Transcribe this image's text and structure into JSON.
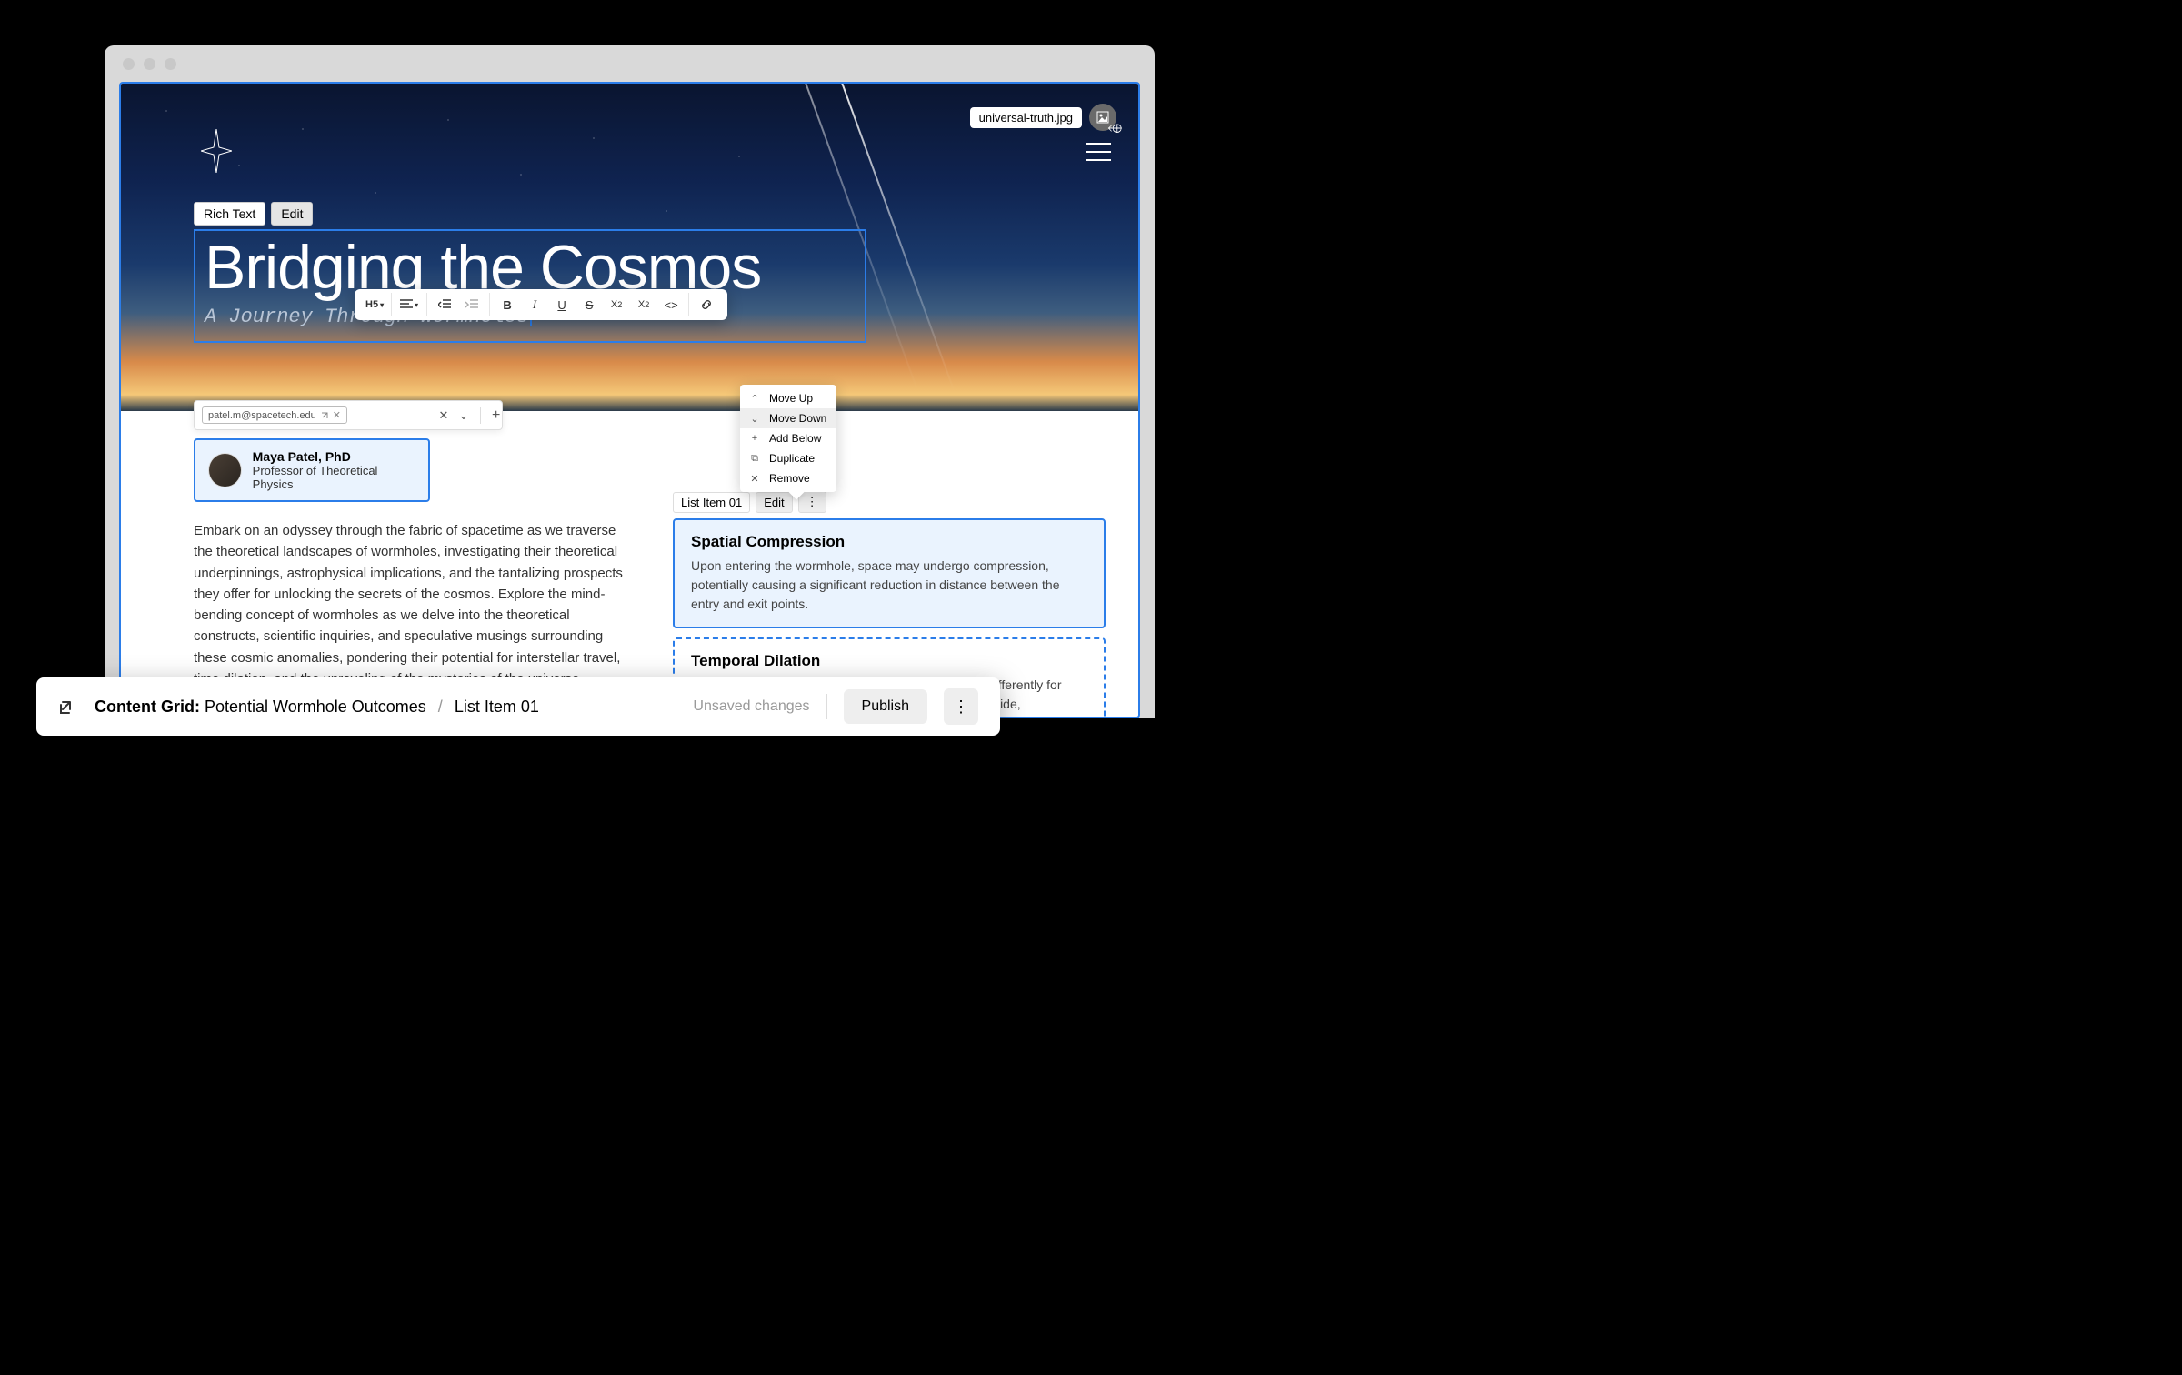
{
  "hero": {
    "image_name": "universal-truth.jpg",
    "field_label": "Rich Text",
    "edit_label": "Edit",
    "title": "Bridging the Cosmos",
    "subtitle": "A Journey Through Wormholes"
  },
  "rt_toolbar": {
    "heading": "H5",
    "buttons": [
      "align",
      "indent-left",
      "indent-right",
      "B",
      "I",
      "U",
      "S",
      "X₂",
      "X²",
      "<>",
      "link"
    ]
  },
  "author_toolbar": {
    "email_chip": "patel.m@spacetech.edu"
  },
  "author": {
    "name": "Maya Patel, PhD",
    "title": "Professor of Theoretical Physics"
  },
  "article_paragraph": "Embark on an odyssey through the fabric of spacetime as we traverse the theoretical landscapes of wormholes, investigating their theoretical underpinnings, astrophysical implications, and the tantalizing prospects they offer for unlocking the secrets of the cosmos. Explore the mind-bending concept of wormholes as we delve into the theoretical constructs, scientific inquiries, and speculative musings surrounding these cosmic anomalies, pondering their potential for interstellar travel, time dilation, and the unraveling of the mysteries of the universe.",
  "list_item": {
    "label": "List Item 01",
    "edit_label": "Edit"
  },
  "cards": [
    {
      "title": "Spatial Compression",
      "body": "Upon entering the wormhole, space may undergo compression, potentially causing a significant reduction in distance between the entry and exit points."
    },
    {
      "title": "Temporal Dilation",
      "body": "Time dilation effects could occur, where time passes differently for those inside the wormhole compared to observers outside,"
    }
  ],
  "context_menu": {
    "move_up": "Move Up",
    "move_down": "Move Down",
    "add_below": "Add Below",
    "duplicate": "Duplicate",
    "remove": "Remove"
  },
  "bottom_bar": {
    "group_label": "Content Grid:",
    "group_value": "Potential Wormhole Outcomes",
    "crumb_item": "List Item 01",
    "status": "Unsaved changes",
    "publish": "Publish"
  }
}
